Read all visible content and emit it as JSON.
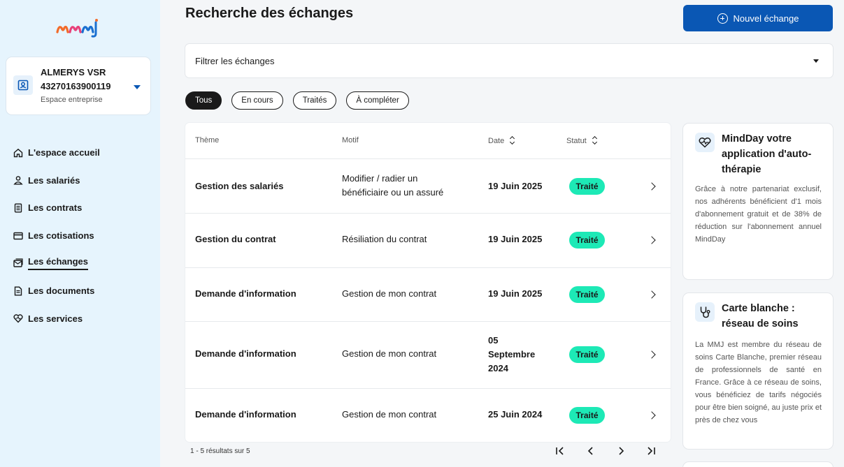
{
  "sidebar": {
    "account": {
      "name": "ALMERYS VSR",
      "id": "43270163900119",
      "subtitle": "Espace entreprise"
    },
    "items": [
      {
        "label": "L'espace accueil",
        "icon": "home-icon"
      },
      {
        "label": "Les salariés",
        "icon": "user-icon"
      },
      {
        "label": "Les contrats",
        "icon": "contract-icon"
      },
      {
        "label": "Les cotisations",
        "icon": "card-icon"
      },
      {
        "label": "Les échanges",
        "icon": "messages-icon",
        "active": true
      },
      {
        "label": "Les documents",
        "icon": "document-icon"
      },
      {
        "label": "Les services",
        "icon": "heart-hands-icon"
      }
    ]
  },
  "header": {
    "title": "Recherche des échanges",
    "new_button": "Nouvel échange"
  },
  "filter": {
    "label": "Filtrer les échanges"
  },
  "chips": [
    "Tous",
    "En cours",
    "Traités",
    "À compléter"
  ],
  "table": {
    "columns": [
      "Thème",
      "Motif",
      "Date",
      "Statut"
    ],
    "rows": [
      {
        "theme": "Gestion des salariés",
        "motif": "Modifier / radier un bénéficiaire ou un assuré",
        "date": "19 Juin 2025",
        "status": "Traité"
      },
      {
        "theme": "Gestion du contrat",
        "motif": "Résiliation du contrat",
        "date": "19 Juin 2025",
        "status": "Traité"
      },
      {
        "theme": "Demande d'information",
        "motif": "Gestion de mon contrat",
        "date": "19 Juin 2025",
        "status": "Traité"
      },
      {
        "theme": "Demande d'information",
        "motif": "Gestion de mon contrat",
        "date": "05 Septembre 2024",
        "status": "Traité"
      },
      {
        "theme": "Demande d'information",
        "motif": "Gestion de mon contrat",
        "date": "25 Juin 2024",
        "status": "Traité"
      }
    ],
    "result_count": "1 - 5 résultats sur 5"
  },
  "cards": [
    {
      "title": "MindDay votre application d'auto-thérapie",
      "text": "Grâce à notre partenariat exclusif, nos adhérents bénéficient d'1 mois d'abonnement gratuit et de 38% de réduction sur l'abonnement annuel MindDay",
      "icon": "heart-pulse-icon"
    },
    {
      "title": "Carte blanche : réseau de soins",
      "text": "La MMJ est membre du réseau de soins Carte Blanche, premier réseau de professionnels de santé en France. Grâce à ce réseau de soins, vous bénéficiez de tarifs négociés pour être bien soigné, au juste prix et près de chez vous",
      "icon": "stethoscope-icon"
    }
  ],
  "colors": {
    "primary": "#0a57b4",
    "status_done": "#1de9b6",
    "sidebar_bg": "#e6f4fd"
  }
}
